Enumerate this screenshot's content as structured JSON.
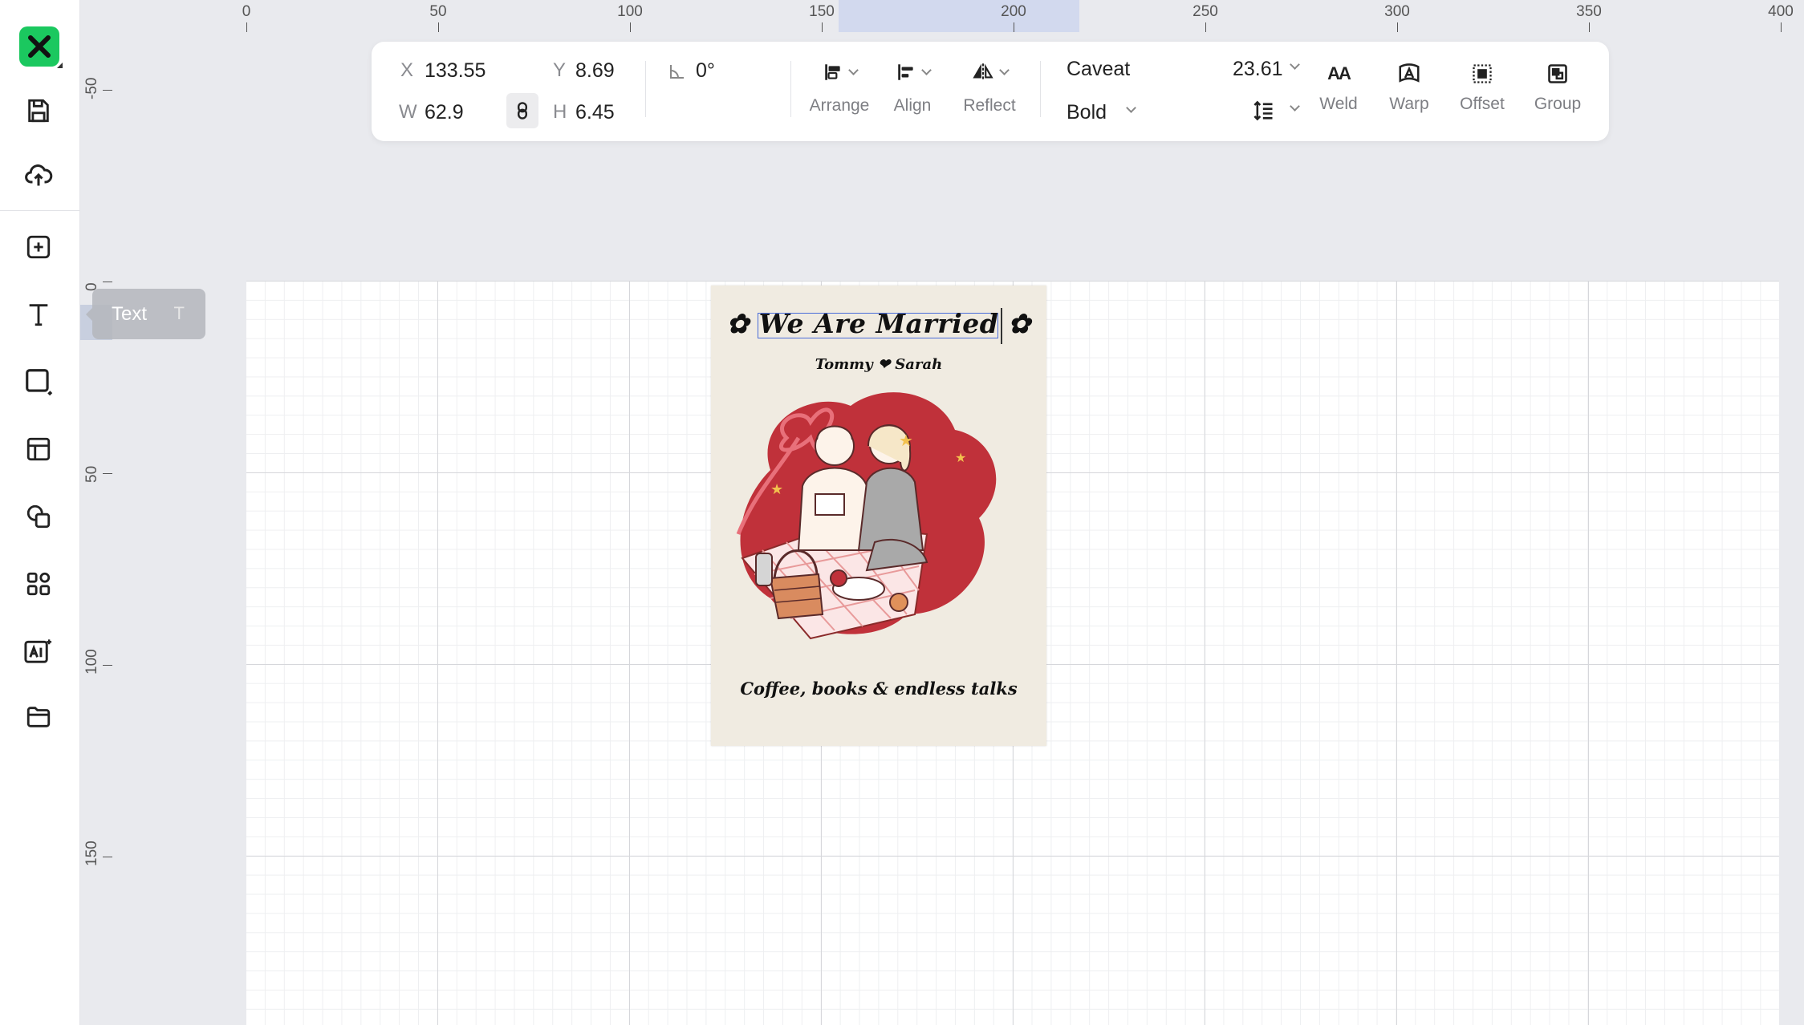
{
  "ruler": {
    "top": [
      "0",
      "50",
      "100",
      "150",
      "200",
      "250",
      "300",
      "350",
      "400"
    ],
    "left": [
      "-50",
      "0",
      "50",
      "100",
      "150"
    ]
  },
  "tooltip": {
    "label": "Text",
    "shortcut": "T"
  },
  "toolbar": {
    "x_label": "X",
    "x_value": "133.55",
    "y_label": "Y",
    "y_value": "8.69",
    "w_label": "W",
    "w_value": "62.9",
    "h_label": "H",
    "h_value": "6.45",
    "rotation_value": "0°",
    "arrange_label": "Arrange",
    "align_label": "Align",
    "reflect_label": "Reflect",
    "font_family": "Caveat",
    "font_weight": "Bold",
    "font_size": "23.61",
    "weld_label": "Weld",
    "warp_label": "Warp",
    "offset_label": "Offset",
    "group_label": "Group"
  },
  "card": {
    "title": "✿ We Are Married ✿",
    "names": "Tommy ❤ Sarah",
    "tagline": "Coffee, books & endless talks"
  },
  "colors": {
    "accent": "#1bc85f",
    "selection": "#4a6cd8",
    "card_red": "#c0313a",
    "card_bg": "#f0ebe1"
  }
}
